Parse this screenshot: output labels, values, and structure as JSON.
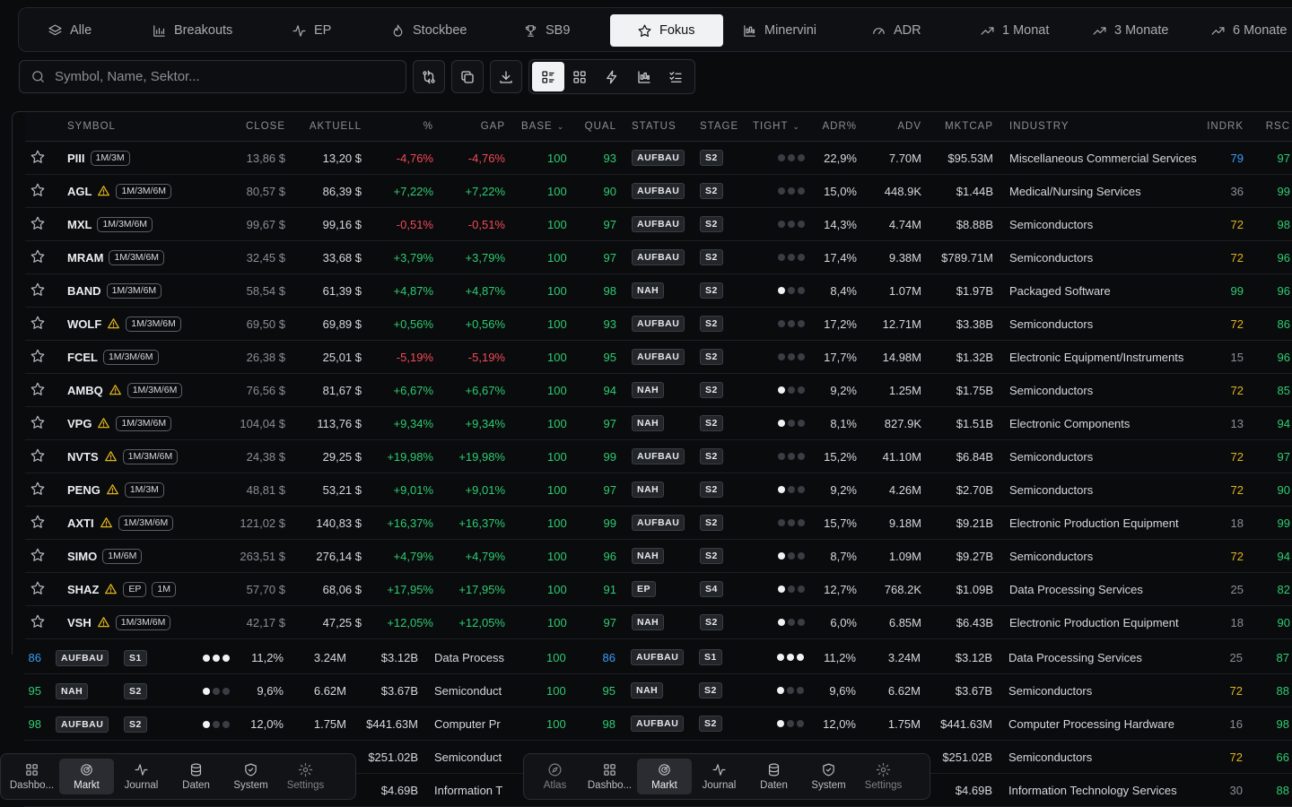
{
  "tabs": [
    {
      "label": "Alle",
      "icon": "layers-icon"
    },
    {
      "label": "Breakouts",
      "icon": "bar-chart-icon"
    },
    {
      "label": "EP",
      "icon": "pulse-icon"
    },
    {
      "label": "Stockbee",
      "icon": "flame-icon"
    },
    {
      "label": "SB9",
      "icon": "trophy-icon"
    },
    {
      "label": "Fokus",
      "icon": "star-icon",
      "active": true
    },
    {
      "label": "Minervini",
      "icon": "candles-icon"
    },
    {
      "label": "ADR",
      "icon": "gauge-icon"
    },
    {
      "label": "1 Monat",
      "icon": "trend-up-icon"
    },
    {
      "label": "3 Monate",
      "icon": "trend-up-icon"
    },
    {
      "label": "6 Monate",
      "icon": "trend-up-icon"
    }
  ],
  "search": {
    "placeholder": "Symbol, Name, Sektor..."
  },
  "columns": {
    "symbol": "SYMBOL",
    "close": "CLOSE",
    "aktuell": "AKTUELL",
    "pct": "%",
    "gap": "GAP",
    "base": "BASE",
    "qual": "QUAL",
    "status": "STATUS",
    "stage": "STAGE",
    "tight": "TIGHT",
    "adr": "ADR%",
    "adv": "ADV",
    "mktcap": "MKTCAP",
    "industry": "INDUSTRY",
    "indrk": "INDRK",
    "rsc": "RSC"
  },
  "rows": [
    {
      "symbol": "PIII",
      "warn": false,
      "tags": "1M/3M",
      "close": "13,86 $",
      "aktuell": "13,20 $",
      "pct": "-4,76%",
      "gap": "-4,76%",
      "base": "100",
      "qual": "93",
      "status": "AUFBAU",
      "stage": "S2",
      "tight": 0,
      "adr": "22,9%",
      "adv": "7.70M",
      "mktcap": "$95.53M",
      "industry": "Miscellaneous Commercial Services",
      "indrk": "79",
      "indrk_color": "blue",
      "rsc": "97"
    },
    {
      "symbol": "AGL",
      "warn": true,
      "tags": "1M/3M/6M",
      "close": "80,57 $",
      "aktuell": "86,39 $",
      "pct": "+7,22%",
      "gap": "+7,22%",
      "base": "100",
      "qual": "90",
      "status": "AUFBAU",
      "stage": "S2",
      "tight": 0,
      "adr": "15,0%",
      "adv": "448.9K",
      "mktcap": "$1.44B",
      "industry": "Medical/Nursing Services",
      "indrk": "36",
      "indrk_color": "muted",
      "rsc": "99"
    },
    {
      "symbol": "MXL",
      "warn": false,
      "tags": "1M/3M/6M",
      "close": "99,67 $",
      "aktuell": "99,16 $",
      "pct": "-0,51%",
      "gap": "-0,51%",
      "base": "100",
      "qual": "97",
      "status": "AUFBAU",
      "stage": "S2",
      "tight": 0,
      "adr": "14,3%",
      "adv": "4.74M",
      "mktcap": "$8.88B",
      "industry": "Semiconductors",
      "indrk": "72",
      "indrk_color": "gold",
      "rsc": "98"
    },
    {
      "symbol": "MRAM",
      "warn": false,
      "tags": "1M/3M/6M",
      "close": "32,45 $",
      "aktuell": "33,68 $",
      "pct": "+3,79%",
      "gap": "+3,79%",
      "base": "100",
      "qual": "97",
      "status": "AUFBAU",
      "stage": "S2",
      "tight": 0,
      "adr": "17,4%",
      "adv": "9.38M",
      "mktcap": "$789.71M",
      "industry": "Semiconductors",
      "indrk": "72",
      "indrk_color": "gold",
      "rsc": "96"
    },
    {
      "symbol": "BAND",
      "warn": false,
      "tags": "1M/3M/6M",
      "close": "58,54 $",
      "aktuell": "61,39 $",
      "pct": "+4,87%",
      "gap": "+4,87%",
      "base": "100",
      "qual": "98",
      "status": "NAH",
      "stage": "S2",
      "tight": 1,
      "adr": "8,4%",
      "adv": "1.07M",
      "mktcap": "$1.97B",
      "industry": "Packaged Software",
      "indrk": "99",
      "indrk_color": "green",
      "rsc": "96"
    },
    {
      "symbol": "WOLF",
      "warn": true,
      "tags": "1M/3M/6M",
      "close": "69,50 $",
      "aktuell": "69,89 $",
      "pct": "+0,56%",
      "gap": "+0,56%",
      "base": "100",
      "qual": "93",
      "status": "AUFBAU",
      "stage": "S2",
      "tight": 0,
      "adr": "17,2%",
      "adv": "12.71M",
      "mktcap": "$3.38B",
      "industry": "Semiconductors",
      "indrk": "72",
      "indrk_color": "gold",
      "rsc": "86"
    },
    {
      "symbol": "FCEL",
      "warn": false,
      "tags": "1M/3M/6M",
      "close": "26,38 $",
      "aktuell": "25,01 $",
      "pct": "-5,19%",
      "gap": "-5,19%",
      "base": "100",
      "qual": "95",
      "status": "AUFBAU",
      "stage": "S2",
      "tight": 0,
      "adr": "17,7%",
      "adv": "14.98M",
      "mktcap": "$1.32B",
      "industry": "Electronic Equipment/Instruments",
      "indrk": "15",
      "indrk_color": "muted",
      "rsc": "96"
    },
    {
      "symbol": "AMBQ",
      "warn": true,
      "tags": "1M/3M/6M",
      "close": "76,56 $",
      "aktuell": "81,67 $",
      "pct": "+6,67%",
      "gap": "+6,67%",
      "base": "100",
      "qual": "94",
      "status": "NAH",
      "stage": "S2",
      "tight": 1,
      "adr": "9,2%",
      "adv": "1.25M",
      "mktcap": "$1.75B",
      "industry": "Semiconductors",
      "indrk": "72",
      "indrk_color": "gold",
      "rsc": "85"
    },
    {
      "symbol": "VPG",
      "warn": true,
      "tags": "1M/3M/6M",
      "close": "104,04 $",
      "aktuell": "113,76 $",
      "pct": "+9,34%",
      "gap": "+9,34%",
      "base": "100",
      "qual": "97",
      "status": "NAH",
      "stage": "S2",
      "tight": 1,
      "adr": "8,1%",
      "adv": "827.9K",
      "mktcap": "$1.51B",
      "industry": "Electronic Components",
      "indrk": "13",
      "indrk_color": "muted",
      "rsc": "94"
    },
    {
      "symbol": "NVTS",
      "warn": true,
      "tags": "1M/3M/6M",
      "close": "24,38 $",
      "aktuell": "29,25 $",
      "pct": "+19,98%",
      "gap": "+19,98%",
      "base": "100",
      "qual": "99",
      "status": "AUFBAU",
      "stage": "S2",
      "tight": 0,
      "adr": "15,2%",
      "adv": "41.10M",
      "mktcap": "$6.84B",
      "industry": "Semiconductors",
      "indrk": "72",
      "indrk_color": "gold",
      "rsc": "97"
    },
    {
      "symbol": "PENG",
      "warn": true,
      "tags": "1M/3M",
      "close": "48,81 $",
      "aktuell": "53,21 $",
      "pct": "+9,01%",
      "gap": "+9,01%",
      "base": "100",
      "qual": "97",
      "status": "NAH",
      "stage": "S2",
      "tight": 1,
      "adr": "9,2%",
      "adv": "4.26M",
      "mktcap": "$2.70B",
      "industry": "Semiconductors",
      "indrk": "72",
      "indrk_color": "gold",
      "rsc": "90"
    },
    {
      "symbol": "AXTI",
      "warn": true,
      "tags": "1M/3M/6M",
      "close": "121,02 $",
      "aktuell": "140,83 $",
      "pct": "+16,37%",
      "gap": "+16,37%",
      "base": "100",
      "qual": "99",
      "status": "AUFBAU",
      "stage": "S2",
      "tight": 0,
      "adr": "15,7%",
      "adv": "9.18M",
      "mktcap": "$9.21B",
      "industry": "Electronic Production Equipment",
      "indrk": "18",
      "indrk_color": "muted",
      "rsc": "99"
    },
    {
      "symbol": "SIMO",
      "warn": false,
      "tags": "1M/6M",
      "close": "263,51 $",
      "aktuell": "276,14 $",
      "pct": "+4,79%",
      "gap": "+4,79%",
      "base": "100",
      "qual": "96",
      "status": "NAH",
      "stage": "S2",
      "tight": 1,
      "adr": "8,7%",
      "adv": "1.09M",
      "mktcap": "$9.27B",
      "industry": "Semiconductors",
      "indrk": "72",
      "indrk_color": "gold",
      "rsc": "94"
    },
    {
      "symbol": "SHAZ",
      "warn": true,
      "tags": "EP",
      "tags2": "1M",
      "close": "57,70 $",
      "aktuell": "68,06 $",
      "pct": "+17,95%",
      "gap": "+17,95%",
      "base": "100",
      "qual": "91",
      "status": "EP",
      "stage": "S4",
      "tight": 1,
      "adr": "12,7%",
      "adv": "768.2K",
      "mktcap": "$1.09B",
      "industry": "Data Processing Services",
      "indrk": "25",
      "indrk_color": "muted",
      "rsc": "82"
    },
    {
      "symbol": "VSH",
      "warn": true,
      "tags": "1M/3M/6M",
      "close": "42,17 $",
      "aktuell": "47,25 $",
      "pct": "+12,05%",
      "gap": "+12,05%",
      "base": "100",
      "qual": "97",
      "status": "NAH",
      "stage": "S2",
      "tight": 1,
      "adr": "6,0%",
      "adv": "6.85M",
      "mktcap": "$6.43B",
      "industry": "Electronic Production Equipment",
      "indrk": "18",
      "indrk_color": "muted",
      "rsc": "90"
    }
  ],
  "lower_rows": [
    {
      "lead": "86",
      "lead_color": "blue",
      "status": "AUFBAU",
      "stage": "S1",
      "tight": 3,
      "adr": "11,2%",
      "adv": "3.24M",
      "mktcap": "$3.12B",
      "ind_short": "Data Process",
      "base": "100",
      "qual": "86",
      "qual_color": "blue",
      "industry": "Data Processing Services",
      "indrk": "25",
      "indrk_color": "muted",
      "rsc": "87"
    },
    {
      "lead": "95",
      "lead_color": "green",
      "status": "NAH",
      "stage": "S2",
      "tight": 1,
      "adr": "9,6%",
      "adv": "6.62M",
      "mktcap": "$3.67B",
      "ind_short": "Semiconduct",
      "base": "100",
      "qual": "95",
      "qual_color": "green",
      "industry": "Semiconductors",
      "indrk": "72",
      "indrk_color": "gold",
      "rsc": "88"
    },
    {
      "lead": "98",
      "lead_color": "green",
      "status": "AUFBAU",
      "stage": "S2",
      "tight": 1,
      "adr": "12,0%",
      "adv": "1.75M",
      "mktcap": "$441.63M",
      "ind_short": "Computer Pr",
      "base": "100",
      "qual": "98",
      "qual_color": "green",
      "industry": "Computer Processing Hardware",
      "indrk": "16",
      "indrk_color": "muted",
      "rsc": "98"
    },
    {
      "lead": "",
      "lead_color": "green",
      "status": "",
      "stage": "",
      "tight": 0,
      "adr": "",
      "adv": "",
      "mktcap": "$251.02B",
      "ind_short": "Semiconduct",
      "base": "",
      "qual": "",
      "qual_color": "green",
      "industry": "Semiconductors",
      "indrk": "72",
      "indrk_color": "gold",
      "rsc": "66"
    },
    {
      "lead": "",
      "lead_color": "green",
      "status": "",
      "stage": "",
      "tight": 0,
      "adr": "",
      "adv": "",
      "mktcap": "$4.69B",
      "ind_short": "Information T",
      "base": "",
      "qual": "",
      "qual_color": "green",
      "industry": "Information Technology Services",
      "indrk": "30",
      "indrk_color": "muted",
      "rsc": "88"
    }
  ],
  "navbar_left": [
    {
      "label": "Dashbo...",
      "icon": "grid-icon"
    },
    {
      "label": "Markt",
      "icon": "radar-icon",
      "active": true
    },
    {
      "label": "Journal",
      "icon": "pulse-icon"
    },
    {
      "label": "Daten",
      "icon": "database-icon"
    },
    {
      "label": "System",
      "icon": "shield-icon"
    },
    {
      "label": "Settings",
      "icon": "gear-icon",
      "dim": true
    }
  ],
  "navbar_right": [
    {
      "label": "Atlas",
      "icon": "compass-icon",
      "dim": true
    },
    {
      "label": "Dashbo...",
      "icon": "grid-icon"
    },
    {
      "label": "Markt",
      "icon": "radar-icon",
      "active": true
    },
    {
      "label": "Journal",
      "icon": "pulse-icon"
    },
    {
      "label": "Daten",
      "icon": "database-icon"
    },
    {
      "label": "System",
      "icon": "shield-icon"
    },
    {
      "label": "Settings",
      "icon": "gear-icon",
      "dim": true
    }
  ],
  "colors": {
    "positive": "#2ecc71",
    "negative": "#f24a56",
    "gold": "#e0b31c",
    "blue": "#3b9ef5"
  }
}
